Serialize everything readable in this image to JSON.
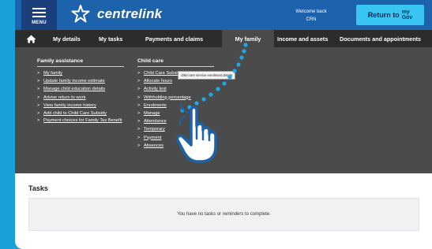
{
  "header": {
    "menu_label": "MENU",
    "logo_text": "centrelink",
    "welcome_line1": "Welcome back",
    "welcome_line2": "CRN",
    "return_label": "Return to",
    "mygov_line1": "my",
    "mygov_line2": "Gov"
  },
  "nav": {
    "home_icon": "home-icon",
    "items": [
      "My details",
      "My tasks",
      "Payments and claims",
      "My family",
      "Income and assets",
      "Documents and appointments"
    ],
    "active": "My family"
  },
  "menu": {
    "family_assistance": {
      "heading": "Family assistance",
      "links": [
        "My family",
        "Update family income estimate",
        "Manage child education details",
        "Advise return to work",
        "View family income history",
        "Add child to Child Care Subsidy",
        "Payment choices for Family Tax Benefit"
      ]
    },
    "child_care": {
      "heading": "Child care",
      "links": [
        "Child Care Subsidy summary",
        "Allocate hours",
        "Activity test",
        "Withholding percentage",
        "Enrolments",
        "Manage",
        "Attendance",
        "Temporary",
        "Payment",
        "Absences"
      ],
      "link_tails": [
        "",
        "",
        "",
        "",
        "",
        "",
        "",
        "ship",
        "",
        ""
      ]
    },
    "tooltip": "child care service enrolment details",
    "arrow": ">"
  },
  "tasks": {
    "title": "Tasks",
    "empty_message": "You have no tasks or reminders to complete."
  },
  "colors": {
    "background": "#19a0d8",
    "header": "#1d63ab",
    "nav": "#2c2c2c",
    "panel": "#4b4b4b",
    "return_button": "#39c5f2",
    "dots": "#1ea9e6"
  }
}
